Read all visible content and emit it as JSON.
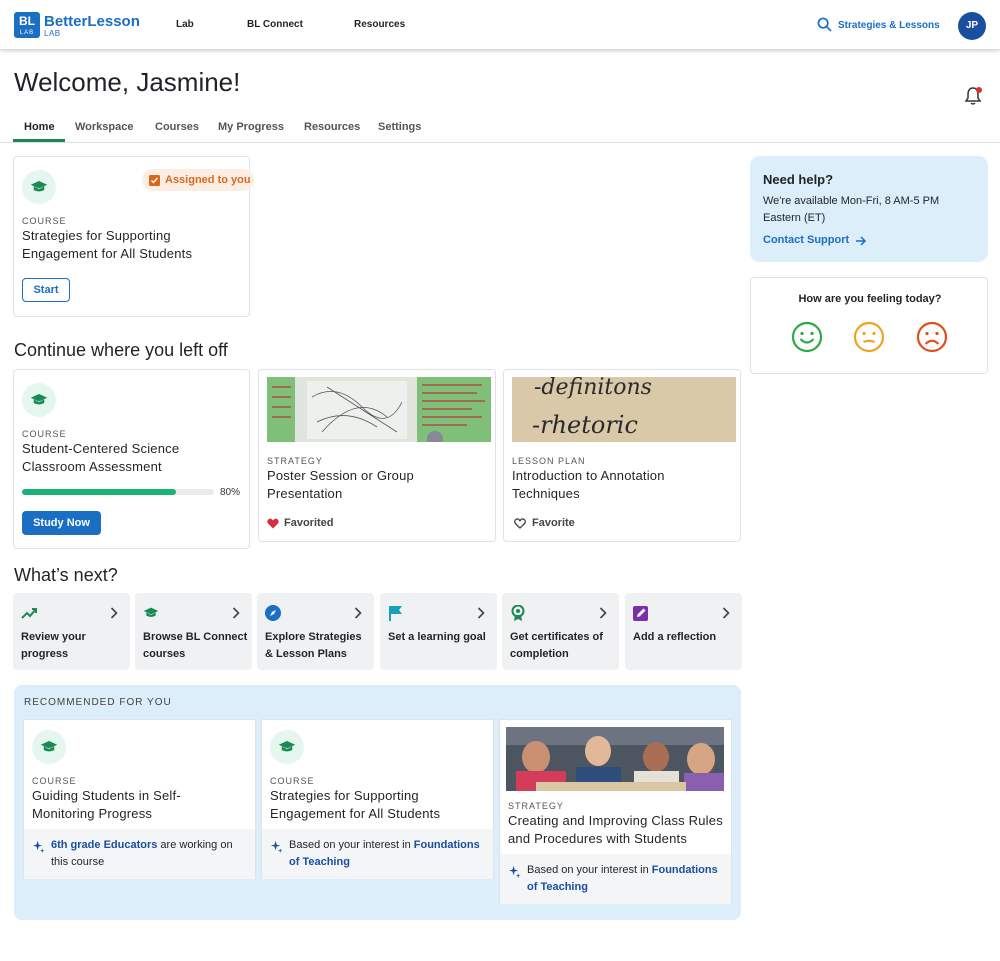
{
  "header": {
    "logo_bl": "BL",
    "logo_lab": "LAB",
    "logo_name": "BetterLesson",
    "logo_sub": "LAB",
    "nav": [
      "Lab",
      "BL Connect",
      "Resources"
    ],
    "search_label": "Strategies & Lessons",
    "avatar_initials": "JP"
  },
  "welcome": "Welcome, Jasmine!",
  "tabs": [
    "Home",
    "Workspace",
    "Courses",
    "My Progress",
    "Resources",
    "Settings"
  ],
  "assigned": {
    "badge": "Assigned to you",
    "kicker": "COURSE",
    "title": "Strategies for Supporting Engagement for All Students",
    "button": "Start"
  },
  "help": {
    "title": "Need help?",
    "body": "We're available Mon-Fri, 8 AM-5 PM Eastern (ET)",
    "link": "Contact Support"
  },
  "feeling": {
    "question": "How are you feeling today?"
  },
  "continue": {
    "heading": "Continue where you left off",
    "course": {
      "kicker": "COURSE",
      "title": "Student-Centered Science Classroom Assessment",
      "progress_label": "80%",
      "progress_value": 0.8,
      "button": "Study Now"
    },
    "strategy": {
      "kicker": "STRATEGY",
      "title": "Poster Session or Group Presentation",
      "fav": "Favorited"
    },
    "lesson": {
      "kicker": "LESSON PLAN",
      "title": "Introduction to Annotation Techniques",
      "fav": "Favorite",
      "photo_text_1": "-definitons",
      "photo_text_2": "-rhetoric"
    }
  },
  "whats_next": {
    "heading": "What’s next?",
    "items": [
      {
        "label": "Review your progress",
        "icon": "trending-up-icon"
      },
      {
        "label": "Browse BL Connect courses",
        "icon": "graduation-cap-icon"
      },
      {
        "label": "Explore Strategies & Lesson Plans",
        "icon": "compass-icon"
      },
      {
        "label": "Set a learning goal",
        "icon": "flag-icon"
      },
      {
        "label": "Get certificates of completion",
        "icon": "award-icon"
      },
      {
        "label": "Add a reflection",
        "icon": "edit-icon"
      }
    ]
  },
  "recommended": {
    "heading": "RECOMMENDED FOR YOU",
    "cards": [
      {
        "kicker": "COURSE",
        "title": "Guiding Students in Self-Monitoring Progress",
        "foot_link": "6th grade Educators",
        "foot_text": " are working on this course"
      },
      {
        "kicker": "COURSE",
        "title": "Strategies for Supporting Engagement for All Students",
        "foot_text": "Based on your interest in ",
        "foot_link": "Foundations of Teaching"
      },
      {
        "kicker": "STRATEGY",
        "title": "Creating and Improving Class Rules and Procedures with Students",
        "foot_text": "Based on your interest in ",
        "foot_link": "Foundations of Teaching"
      }
    ]
  },
  "colors": {
    "brand_blue": "#1a6ec3",
    "green": "#1a8a55",
    "progress": "#19b37a",
    "happy": "#2eaa44",
    "neutral": "#f0a322",
    "sad": "#e0501e"
  }
}
